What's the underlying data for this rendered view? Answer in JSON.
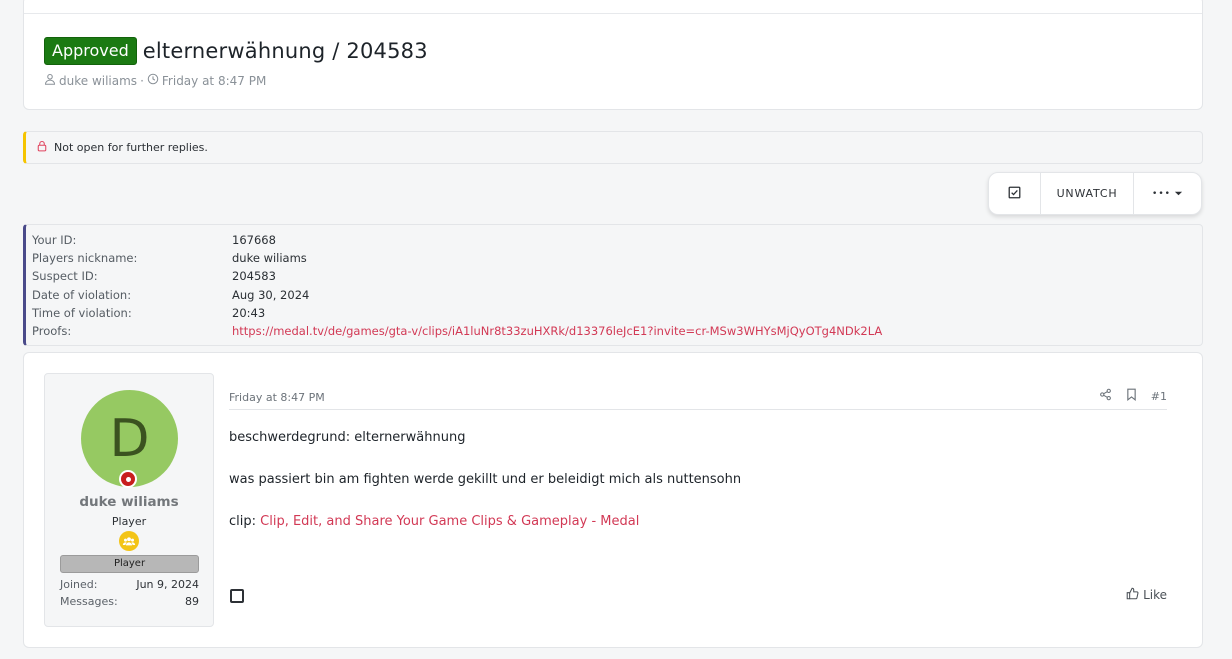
{
  "thread": {
    "badge": "Approved",
    "title": "elternerwähnung / 204583",
    "author": "duke wiliams",
    "separator": "·",
    "date": "Friday at 8:47 PM",
    "badge_color": "#1b7a12"
  },
  "notice": {
    "text": "Not open for further replies."
  },
  "toolbar": {
    "unwatch_label": "UNWATCH",
    "more_label": "•••"
  },
  "report": {
    "rows": [
      {
        "label": "Your ID:",
        "value": "167668"
      },
      {
        "label": "Players nickname:",
        "value": "duke wiliams"
      },
      {
        "label": "Suspect ID:",
        "value": "204583"
      },
      {
        "label": "Date of violation:",
        "value": "Aug 30, 2024"
      },
      {
        "label": "Time of violation:",
        "value": "20:43"
      },
      {
        "label": "Proofs:",
        "value": "https://medal.tv/de/games/gta-v/clips/iA1luNr8t33zuHXRk/d13376leJcE1?invite=cr-MSw3WHYsMjQyOTg4NDk2LA"
      }
    ]
  },
  "post": {
    "user": {
      "avatar_letter": "D",
      "name": "duke wiliams",
      "title": "Player",
      "banner": "Player",
      "joined_label": "Joined:",
      "joined_value": "Jun 9, 2024",
      "messages_label": "Messages:",
      "messages_value": "89"
    },
    "date": "Friday at 8:47 PM",
    "number": "#1",
    "body": {
      "line1": "beschwerdegrund: elternerwähnung",
      "line2": "was passiert bin am fighten werde gekillt und er beleidigt mich als nuttensohn",
      "clip_prefix": "clip: ",
      "clip_link": "Clip, Edit, and Share Your Game Clips & Gameplay - Medal"
    },
    "like_label": "Like"
  }
}
